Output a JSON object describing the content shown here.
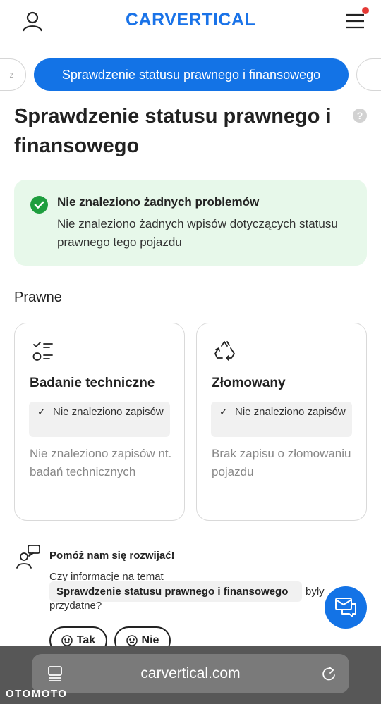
{
  "header": {
    "logo": "CARVERTICAL",
    "user_icon": "user-icon",
    "menu_icon": "hamburger-menu-icon",
    "notification_color": "#e53935"
  },
  "tabs": {
    "prev_label": "z",
    "active_label": "Sprawdzenie statusu prawnego i finansowego",
    "accent_color": "#1373e6",
    "progress": 0.3
  },
  "page": {
    "title": "Sprawdzenie statusu prawnego i finansowego",
    "help_icon": "?"
  },
  "alert": {
    "icon": "check-circle-icon",
    "title": "Nie znaleziono żadnych problemów",
    "text": "Nie znaleziono żadnych wpisów dotyczących statusu prawnego tego pojazdu",
    "bg_color": "#e7f8ea",
    "icon_color": "#1e9e3e"
  },
  "section": {
    "title": "Prawne"
  },
  "cards": [
    {
      "icon": "checklist-icon",
      "title": "Badanie techniczne",
      "badge_check": "✓",
      "badge": "Nie znaleziono zapisów",
      "desc": "Nie znaleziono zapisów nt. badań technicznych"
    },
    {
      "icon": "recycle-icon",
      "title": "Złomowany",
      "badge_check": "✓",
      "badge": "Nie znaleziono zapisów",
      "desc": "Brak zapisu o złomowaniu pojazdu"
    }
  ],
  "feedback": {
    "icon": "feedback-people-icon",
    "title": "Pomóż nam się rozwijać!",
    "question_start": "Czy informacje na temat",
    "topic": "Sprawdzenie statusu prawnego i finansowego",
    "question_mid": "były",
    "question_end": "przydatne?",
    "yes_label": "Tak",
    "no_label": "Nie"
  },
  "chat": {
    "icon": "chat-icon"
  },
  "browser": {
    "url": "carvertical.com",
    "tabs_icon": "browser-tabs-icon",
    "reload_icon": "reload-icon"
  },
  "watermark": "OTOMOTO"
}
